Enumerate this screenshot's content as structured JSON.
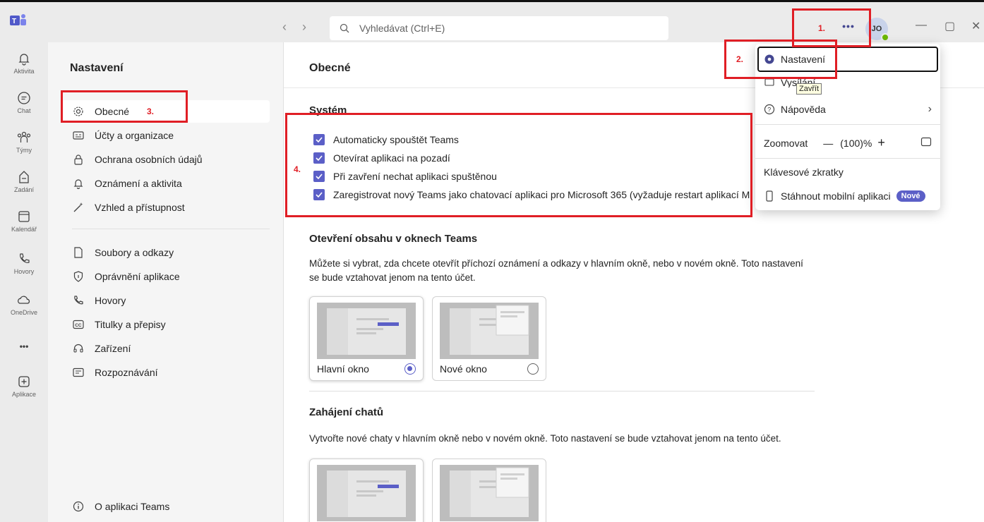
{
  "titlebar": {
    "search_placeholder": "Vyhledávat (Ctrl+E)",
    "more_label": "•••",
    "avatar_initials": "JO",
    "back": "‹",
    "forward": "›",
    "minimize": "—",
    "restore": "▢",
    "close": "✕"
  },
  "rail": [
    {
      "label": "Aktivita",
      "icon": "bell-icon"
    },
    {
      "label": "Chat",
      "icon": "chat-icon"
    },
    {
      "label": "Týmy",
      "icon": "teams-icon"
    },
    {
      "label": "Zadání",
      "icon": "assignments-icon"
    },
    {
      "label": "Kalendář",
      "icon": "calendar-icon"
    },
    {
      "label": "Hovory",
      "icon": "phone-icon"
    },
    {
      "label": "OneDrive",
      "icon": "cloud-icon"
    },
    {
      "label": "•••",
      "icon": "more-icon"
    },
    {
      "label": "Aplikace",
      "icon": "add-app-icon"
    }
  ],
  "settings": {
    "title": "Nastavení",
    "items": [
      {
        "label": "Obecné",
        "icon": "gear-icon"
      },
      {
        "label": "Účty a organizace",
        "icon": "id-card-icon"
      },
      {
        "label": "Ochrana osobních údajů",
        "icon": "lock-icon"
      },
      {
        "label": "Oznámení a aktivita",
        "icon": "bell-icon"
      },
      {
        "label": "Vzhled a přístupnost",
        "icon": "wand-icon"
      },
      {
        "label": "Soubory a odkazy",
        "icon": "file-icon"
      },
      {
        "label": "Oprávnění aplikace",
        "icon": "shield-icon"
      },
      {
        "label": "Hovory",
        "icon": "phone-icon"
      },
      {
        "label": "Titulky a přepisy",
        "icon": "cc-icon"
      },
      {
        "label": "Zařízení",
        "icon": "headset-icon"
      },
      {
        "label": "Rozpoznávání",
        "icon": "recognition-icon"
      }
    ],
    "about": "O aplikaci Teams"
  },
  "main": {
    "title": "Obecné",
    "system": {
      "heading": "Systém",
      "options": [
        "Automaticky spouštět Teams",
        "Otevírat aplikaci na pozadí",
        "Při zavření nechat aplikaci spuštěnou",
        "Zaregistrovat nový Teams jako chatovací aplikaci pro Microsoft 365 (vyžaduje restart aplikací M"
      ]
    },
    "open_content": {
      "heading": "Otevření obsahu v oknech Teams",
      "desc": "Můžete si vybrat, zda chcete otevřít příchozí oznámení a odkazy v hlavním okně, nebo v novém okně. Toto nastavení se bude vztahovat jenom na tento účet.",
      "cards": [
        {
          "label": "Hlavní okno",
          "selected": true
        },
        {
          "label": "Nové okno",
          "selected": false
        }
      ]
    },
    "start_chats": {
      "heading": "Zahájení chatů",
      "desc": "Vytvořte nové chaty v hlavním okně nebo v novém okně. Toto nastavení se bude vztahovat jenom na tento účet."
    }
  },
  "menu": {
    "settings": "Nastavení",
    "cast": "Vysílání",
    "help": "Nápověda",
    "zoom_label": "Zoomovat",
    "zoom_value": "(100)%",
    "zoom_minus": "—",
    "zoom_plus": "+",
    "shortcuts": "Klávesové zkratky",
    "mobile": "Stáhnout mobilní aplikaci",
    "badge": "Nové",
    "tooltip": "Zavřít"
  },
  "annotations": {
    "n1": "1.",
    "n2": "2.",
    "n3": "3.",
    "n4": "4."
  },
  "colors": {
    "accent": "#5b5fc7",
    "annotation_red": "#e01e25"
  }
}
